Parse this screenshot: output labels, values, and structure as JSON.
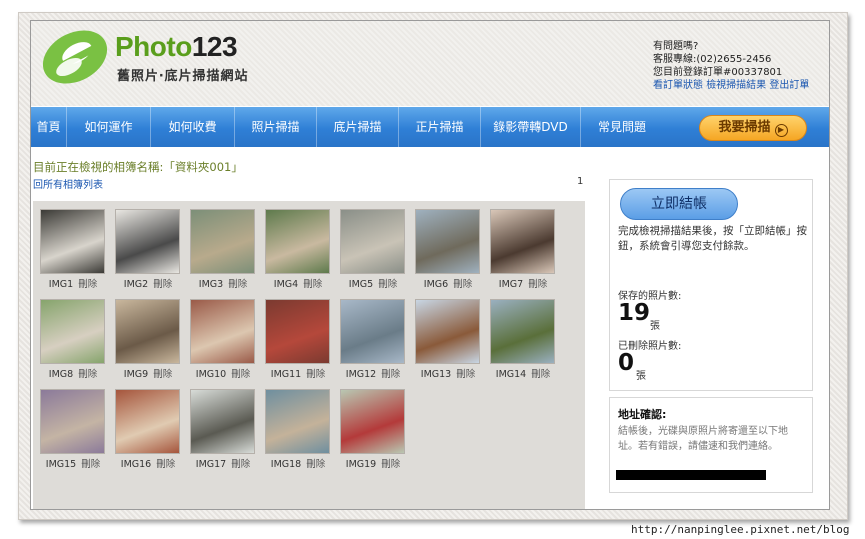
{
  "header": {
    "logo_brand_part1": "Photo",
    "logo_brand_part2": "123",
    "logo_subtitle": "舊照片‧底片掃描網站",
    "help_question": "有問題嗎?",
    "help_phone": "客服專線:(02)2655-2456",
    "help_order": "您目前登錄訂單#00337801",
    "link_order_status": "看訂單狀態",
    "link_scan_results": "檢視掃描結果",
    "link_logout": "登出訂單"
  },
  "nav": {
    "items": [
      "首頁",
      "如何運作",
      "如何收費",
      "照片掃描",
      "底片掃描",
      "正片掃描",
      "錄影帶轉DVD",
      "常見問題"
    ],
    "cta": "我要掃描"
  },
  "content": {
    "album_title": "目前正在檢視的相簿名稱:「資料夾001」",
    "back_link": "回所有相簿列表",
    "page_number": "1",
    "delete_label": "刪除",
    "photos": [
      "IMG1",
      "IMG2",
      "IMG3",
      "IMG4",
      "IMG5",
      "IMG6",
      "IMG7",
      "IMG8",
      "IMG9",
      "IMG10",
      "IMG11",
      "IMG12",
      "IMG13",
      "IMG14",
      "IMG15",
      "IMG16",
      "IMG17",
      "IMG18",
      "IMG19"
    ]
  },
  "sidebar": {
    "checkout_button": "立即結帳",
    "checkout_text": "完成檢視掃描結果後，按「立即結帳」按鈕，系統會引導您支付餘款。",
    "saved_label": "保存的照片數:",
    "saved_count": "19",
    "saved_unit": "張",
    "deleted_label": "已刪除照片數:",
    "deleted_count": "0",
    "deleted_unit": "張",
    "address_title": "地址確認:",
    "address_text": "結帳後，光碟與原照片將寄還至以下地址。若有錯誤，請儘速和我們連絡。"
  },
  "watermark": "http://nanpinglee.pixnet.net/blog",
  "colors": {
    "brand_green": "#5a9e1c",
    "nav_blue": "#2f7fd6",
    "cta_orange": "#f5a623",
    "link_blue": "#1a56b0"
  }
}
